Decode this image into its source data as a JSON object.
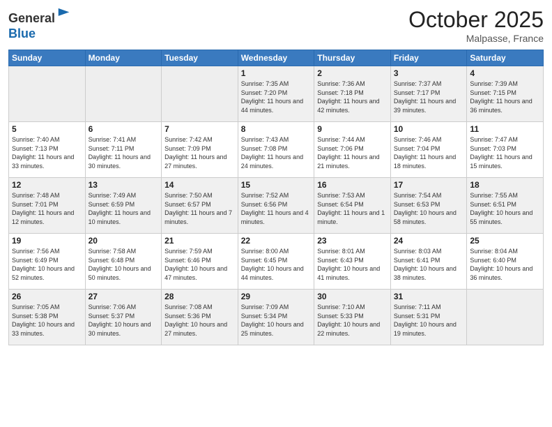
{
  "header": {
    "logo_line1": "General",
    "logo_line2": "Blue",
    "month": "October 2025",
    "location": "Malpasse, France"
  },
  "days_of_week": [
    "Sunday",
    "Monday",
    "Tuesday",
    "Wednesday",
    "Thursday",
    "Friday",
    "Saturday"
  ],
  "weeks": [
    [
      {
        "num": "",
        "info": ""
      },
      {
        "num": "",
        "info": ""
      },
      {
        "num": "",
        "info": ""
      },
      {
        "num": "1",
        "info": "Sunrise: 7:35 AM\nSunset: 7:20 PM\nDaylight: 11 hours and 44 minutes."
      },
      {
        "num": "2",
        "info": "Sunrise: 7:36 AM\nSunset: 7:18 PM\nDaylight: 11 hours and 42 minutes."
      },
      {
        "num": "3",
        "info": "Sunrise: 7:37 AM\nSunset: 7:17 PM\nDaylight: 11 hours and 39 minutes."
      },
      {
        "num": "4",
        "info": "Sunrise: 7:39 AM\nSunset: 7:15 PM\nDaylight: 11 hours and 36 minutes."
      }
    ],
    [
      {
        "num": "5",
        "info": "Sunrise: 7:40 AM\nSunset: 7:13 PM\nDaylight: 11 hours and 33 minutes."
      },
      {
        "num": "6",
        "info": "Sunrise: 7:41 AM\nSunset: 7:11 PM\nDaylight: 11 hours and 30 minutes."
      },
      {
        "num": "7",
        "info": "Sunrise: 7:42 AM\nSunset: 7:09 PM\nDaylight: 11 hours and 27 minutes."
      },
      {
        "num": "8",
        "info": "Sunrise: 7:43 AM\nSunset: 7:08 PM\nDaylight: 11 hours and 24 minutes."
      },
      {
        "num": "9",
        "info": "Sunrise: 7:44 AM\nSunset: 7:06 PM\nDaylight: 11 hours and 21 minutes."
      },
      {
        "num": "10",
        "info": "Sunrise: 7:46 AM\nSunset: 7:04 PM\nDaylight: 11 hours and 18 minutes."
      },
      {
        "num": "11",
        "info": "Sunrise: 7:47 AM\nSunset: 7:03 PM\nDaylight: 11 hours and 15 minutes."
      }
    ],
    [
      {
        "num": "12",
        "info": "Sunrise: 7:48 AM\nSunset: 7:01 PM\nDaylight: 11 hours and 12 minutes."
      },
      {
        "num": "13",
        "info": "Sunrise: 7:49 AM\nSunset: 6:59 PM\nDaylight: 11 hours and 10 minutes."
      },
      {
        "num": "14",
        "info": "Sunrise: 7:50 AM\nSunset: 6:57 PM\nDaylight: 11 hours and 7 minutes."
      },
      {
        "num": "15",
        "info": "Sunrise: 7:52 AM\nSunset: 6:56 PM\nDaylight: 11 hours and 4 minutes."
      },
      {
        "num": "16",
        "info": "Sunrise: 7:53 AM\nSunset: 6:54 PM\nDaylight: 11 hours and 1 minute."
      },
      {
        "num": "17",
        "info": "Sunrise: 7:54 AM\nSunset: 6:53 PM\nDaylight: 10 hours and 58 minutes."
      },
      {
        "num": "18",
        "info": "Sunrise: 7:55 AM\nSunset: 6:51 PM\nDaylight: 10 hours and 55 minutes."
      }
    ],
    [
      {
        "num": "19",
        "info": "Sunrise: 7:56 AM\nSunset: 6:49 PM\nDaylight: 10 hours and 52 minutes."
      },
      {
        "num": "20",
        "info": "Sunrise: 7:58 AM\nSunset: 6:48 PM\nDaylight: 10 hours and 50 minutes."
      },
      {
        "num": "21",
        "info": "Sunrise: 7:59 AM\nSunset: 6:46 PM\nDaylight: 10 hours and 47 minutes."
      },
      {
        "num": "22",
        "info": "Sunrise: 8:00 AM\nSunset: 6:45 PM\nDaylight: 10 hours and 44 minutes."
      },
      {
        "num": "23",
        "info": "Sunrise: 8:01 AM\nSunset: 6:43 PM\nDaylight: 10 hours and 41 minutes."
      },
      {
        "num": "24",
        "info": "Sunrise: 8:03 AM\nSunset: 6:41 PM\nDaylight: 10 hours and 38 minutes."
      },
      {
        "num": "25",
        "info": "Sunrise: 8:04 AM\nSunset: 6:40 PM\nDaylight: 10 hours and 36 minutes."
      }
    ],
    [
      {
        "num": "26",
        "info": "Sunrise: 7:05 AM\nSunset: 5:38 PM\nDaylight: 10 hours and 33 minutes."
      },
      {
        "num": "27",
        "info": "Sunrise: 7:06 AM\nSunset: 5:37 PM\nDaylight: 10 hours and 30 minutes."
      },
      {
        "num": "28",
        "info": "Sunrise: 7:08 AM\nSunset: 5:36 PM\nDaylight: 10 hours and 27 minutes."
      },
      {
        "num": "29",
        "info": "Sunrise: 7:09 AM\nSunset: 5:34 PM\nDaylight: 10 hours and 25 minutes."
      },
      {
        "num": "30",
        "info": "Sunrise: 7:10 AM\nSunset: 5:33 PM\nDaylight: 10 hours and 22 minutes."
      },
      {
        "num": "31",
        "info": "Sunrise: 7:11 AM\nSunset: 5:31 PM\nDaylight: 10 hours and 19 minutes."
      },
      {
        "num": "",
        "info": ""
      }
    ]
  ]
}
